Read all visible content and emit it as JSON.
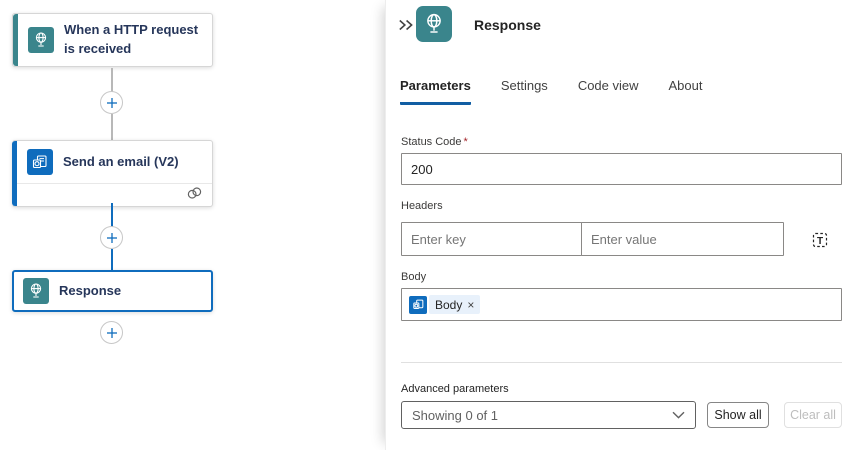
{
  "colors": {
    "teal_accent": "#3a858c",
    "blue_accent": "#0f6cbd",
    "tab_underline": "#115ea3",
    "token_chip_bg": "#e8f1fb",
    "required_red": "#a4262c"
  },
  "canvas": {
    "nodes": [
      {
        "title": "When a HTTP request is received",
        "icon": "http-globe-icon",
        "accent": "#3a858c"
      },
      {
        "title": "Send an email (V2)",
        "icon": "outlook-icon",
        "accent": "#0f6cbd",
        "footer_icon": "connection-icon"
      },
      {
        "title": "Response",
        "icon": "http-globe-icon",
        "accent": "#3a858c",
        "selected": true
      }
    ]
  },
  "panel": {
    "title": "Response",
    "icon": "http-globe-icon",
    "tabs": [
      {
        "label": "Parameters",
        "active": true
      },
      {
        "label": "Settings",
        "active": false
      },
      {
        "label": "Code view",
        "active": false
      },
      {
        "label": "About",
        "active": false
      }
    ],
    "fields": {
      "status_code": {
        "label": "Status Code",
        "required_mark": "*",
        "value": "200"
      },
      "headers": {
        "label": "Headers",
        "key_placeholder": "Enter key",
        "value_placeholder": "Enter value"
      },
      "body": {
        "label": "Body",
        "token_label": "Body",
        "token_close": "×"
      }
    },
    "advanced": {
      "label": "Advanced parameters",
      "dropdown_value": "Showing 0 of 1",
      "show_all": "Show all",
      "clear_all": "Clear all"
    }
  }
}
